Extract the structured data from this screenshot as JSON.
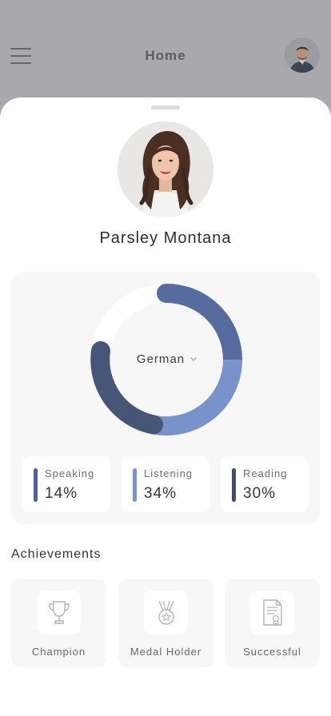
{
  "header": {
    "title": "Home",
    "menu_icon": "hamburger-menu-icon",
    "avatar_icon": "user-avatar"
  },
  "profile": {
    "name": "Parsley Montana",
    "photo_icon": "profile-photo"
  },
  "language": {
    "selected": "German",
    "dropdown_icon": "chevron-down-icon"
  },
  "stats": [
    {
      "label": "Speaking",
      "value": "14%",
      "color": "#4f6195"
    },
    {
      "label": "Listening",
      "value": "34%",
      "color": "#7893c9"
    },
    {
      "label": "Reading",
      "value": "30%",
      "color": "#3e4d6c"
    }
  ],
  "achievements": {
    "title": "Achievements",
    "items": [
      {
        "label": "Champion",
        "icon": "trophy-icon"
      },
      {
        "label": "Medal Holder",
        "icon": "medal-icon"
      },
      {
        "label": "Successful",
        "icon": "certificate-icon"
      }
    ]
  },
  "colors": {
    "accent_dark": "#475676",
    "accent_mid": "#576c9e",
    "accent_light": "#7893c9",
    "card_bg": "#f7f7f8",
    "overlay": "#a9a9ad"
  }
}
